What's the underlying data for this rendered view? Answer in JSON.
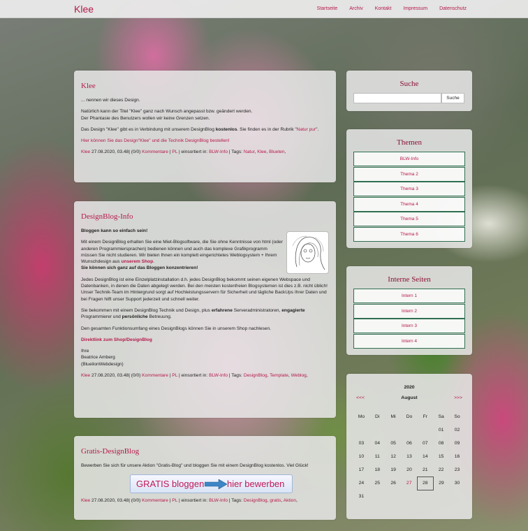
{
  "header": {
    "brand": "Klee",
    "nav": [
      "Startseite",
      "Archiv",
      "Kontakt",
      "Impressum",
      "Datenschutz"
    ]
  },
  "posts": [
    {
      "title": "Klee",
      "p1": "... nennen wir dieses Design.",
      "p2a": "Natürlich kann der Titel \"Klee\" ganz nach Wunsch angepasst bzw. geändert werden.",
      "p2b": "Der Phantasie des Benutzers wollen wir keine Grenzen setzen.",
      "p3a": "Das Design \"Klee\" gibt es in Verbindung mit unserem DesignBlog ",
      "p3b": "kostenlos",
      "p3c": ". Sie finden es in der Rubrik \"",
      "p3link": "Natur pur",
      "p3d": "\".",
      "p4link": "Hier können Sie das Design\"Klee\" und die Technik DesignBlog bestellen!",
      "meta": {
        "author": "Klee",
        "date": "27.08.2020, 03.48",
        "comments_prefix": "(0/0) ",
        "comments": "Kommentare",
        "pl": "PL",
        "cat_prefix": "einsortiert in: ",
        "cat": "BLW-Info",
        "tags_prefix": "Tags: ",
        "tags": [
          "Natur",
          "Klee",
          "Blueten"
        ]
      }
    },
    {
      "title": "DesignBlog-Info",
      "lead": "Bloggen kann so einfach sein!",
      "p1a": "Mit einem DesignBlog erhalten Sie eine Miet-Blogsoftware, die Sie ohne Kenntnisse von html (oder anderen Programmiersprachen) bedienen können und auch das komplexe Grafikprogramm müssen Sie nicht studieren. Wir bieten Ihnen ein komplett eingerichtetes Weblogsystem + Ihrem Wunschdesign aus ",
      "p1link": "unserem Shop",
      "p1b": ".",
      "p1bold": "Sie können sich ganz auf das Bloggen konzentrieren!",
      "p2": "Jedes DesignBlog ist eine Einzelplatzinstallation d.h. jedes DesignBlog bekommt seinen eigenen Webspace und Datenbanken, in denen die Daten abgelegt werden. Bei den meisten kostenfreien Blogsystemen ist dies z.B. nicht üblich!",
      "p2b": "Unser Technik-Team im Hintergrund sorgt auf Hochleistungsservern für Sicherheit und tägliche BackUps Ihrer Daten und bei Fragen hilft unser Support jederzeit und schnell weiter.",
      "p3a": "Sie bekommen mit einem DesignBlog Technik und Design, plus ",
      "p3b": "erfahrene",
      "p3c": " Serveradministratoren, ",
      "p3d": "engagierte",
      "p3e": " Programmierer und ",
      "p3f": "persönliche",
      "p3g": " Betreuung.",
      "p4": "Den gesamten Funktionsumfang eines DesignBlogs können Sie in unserem Shop nachlesen.",
      "p5link": "Direktlink zum Shop/DesignBlog",
      "sig1": "Ihre",
      "sig2": "Beatrice Amberg",
      "sig3": "(BlueilonWebdesign)",
      "meta": {
        "author": "Klee",
        "date": "27.08.2020, 03.48",
        "comments_prefix": "(0/0) ",
        "comments": "Kommentare",
        "pl": "PL",
        "cat_prefix": "einsortiert in: ",
        "cat": "BLW-Info",
        "tags_prefix": "Tags: ",
        "tags": [
          "DesignBlog",
          "Template",
          "Weblog"
        ]
      }
    },
    {
      "title": "Gratis-DesignBlog",
      "p1": "Bewerben Sie sich für unsere Aktion \"Gratis-Blog\" und bloggen Sie mit einem DesignBlog kostenlos. Viel Glück!",
      "banner_left": "GRATIS bloggen",
      "banner_right": "hier bewerben",
      "meta": {
        "author": "Klee",
        "date": "27.08.2020, 03.48",
        "comments_prefix": "(0/0) ",
        "comments": "Kommentare",
        "pl": "PL",
        "cat_prefix": "einsortiert in: ",
        "cat": "BLW-Info",
        "tags_prefix": "Tags: ",
        "tags": [
          "DesignBlog",
          "gratis",
          "Aktion"
        ]
      }
    }
  ],
  "sidebar": {
    "search": {
      "title": "Suche",
      "value": "",
      "button": "Suche"
    },
    "themes": {
      "title": "Themen",
      "items": [
        "BLW-Info",
        "Thema 2",
        "Thema 3",
        "Thema 4",
        "Thema 5",
        "Thema 6"
      ]
    },
    "internal": {
      "title": "Interne Seiten",
      "items": [
        "Intern 1",
        "Intern 2",
        "Intern 3",
        "Intern 4"
      ]
    },
    "calendar": {
      "year": "2020",
      "prev": "<<<",
      "month": "August",
      "next": ">>>",
      "weekdays": [
        "Mo",
        "Di",
        "Mi",
        "Do",
        "Fr",
        "Sa",
        "So"
      ],
      "weeks": [
        [
          "",
          "",
          "",
          "",
          "",
          "01",
          "02"
        ],
        [
          "03",
          "04",
          "05",
          "06",
          "07",
          "08",
          "09"
        ],
        [
          "10",
          "11",
          "12",
          "13",
          "14",
          "15",
          "16"
        ],
        [
          "17",
          "18",
          "19",
          "20",
          "21",
          "22",
          "23"
        ],
        [
          "24",
          "25",
          "26",
          "27",
          "28",
          "29",
          "30"
        ],
        [
          "31",
          "",
          "",
          "",
          "",
          "",
          ""
        ]
      ],
      "highlighted_day": "27",
      "today": "28"
    }
  },
  "colors": {
    "accent": "#b5194a",
    "border_green": "#2f6f4f"
  }
}
